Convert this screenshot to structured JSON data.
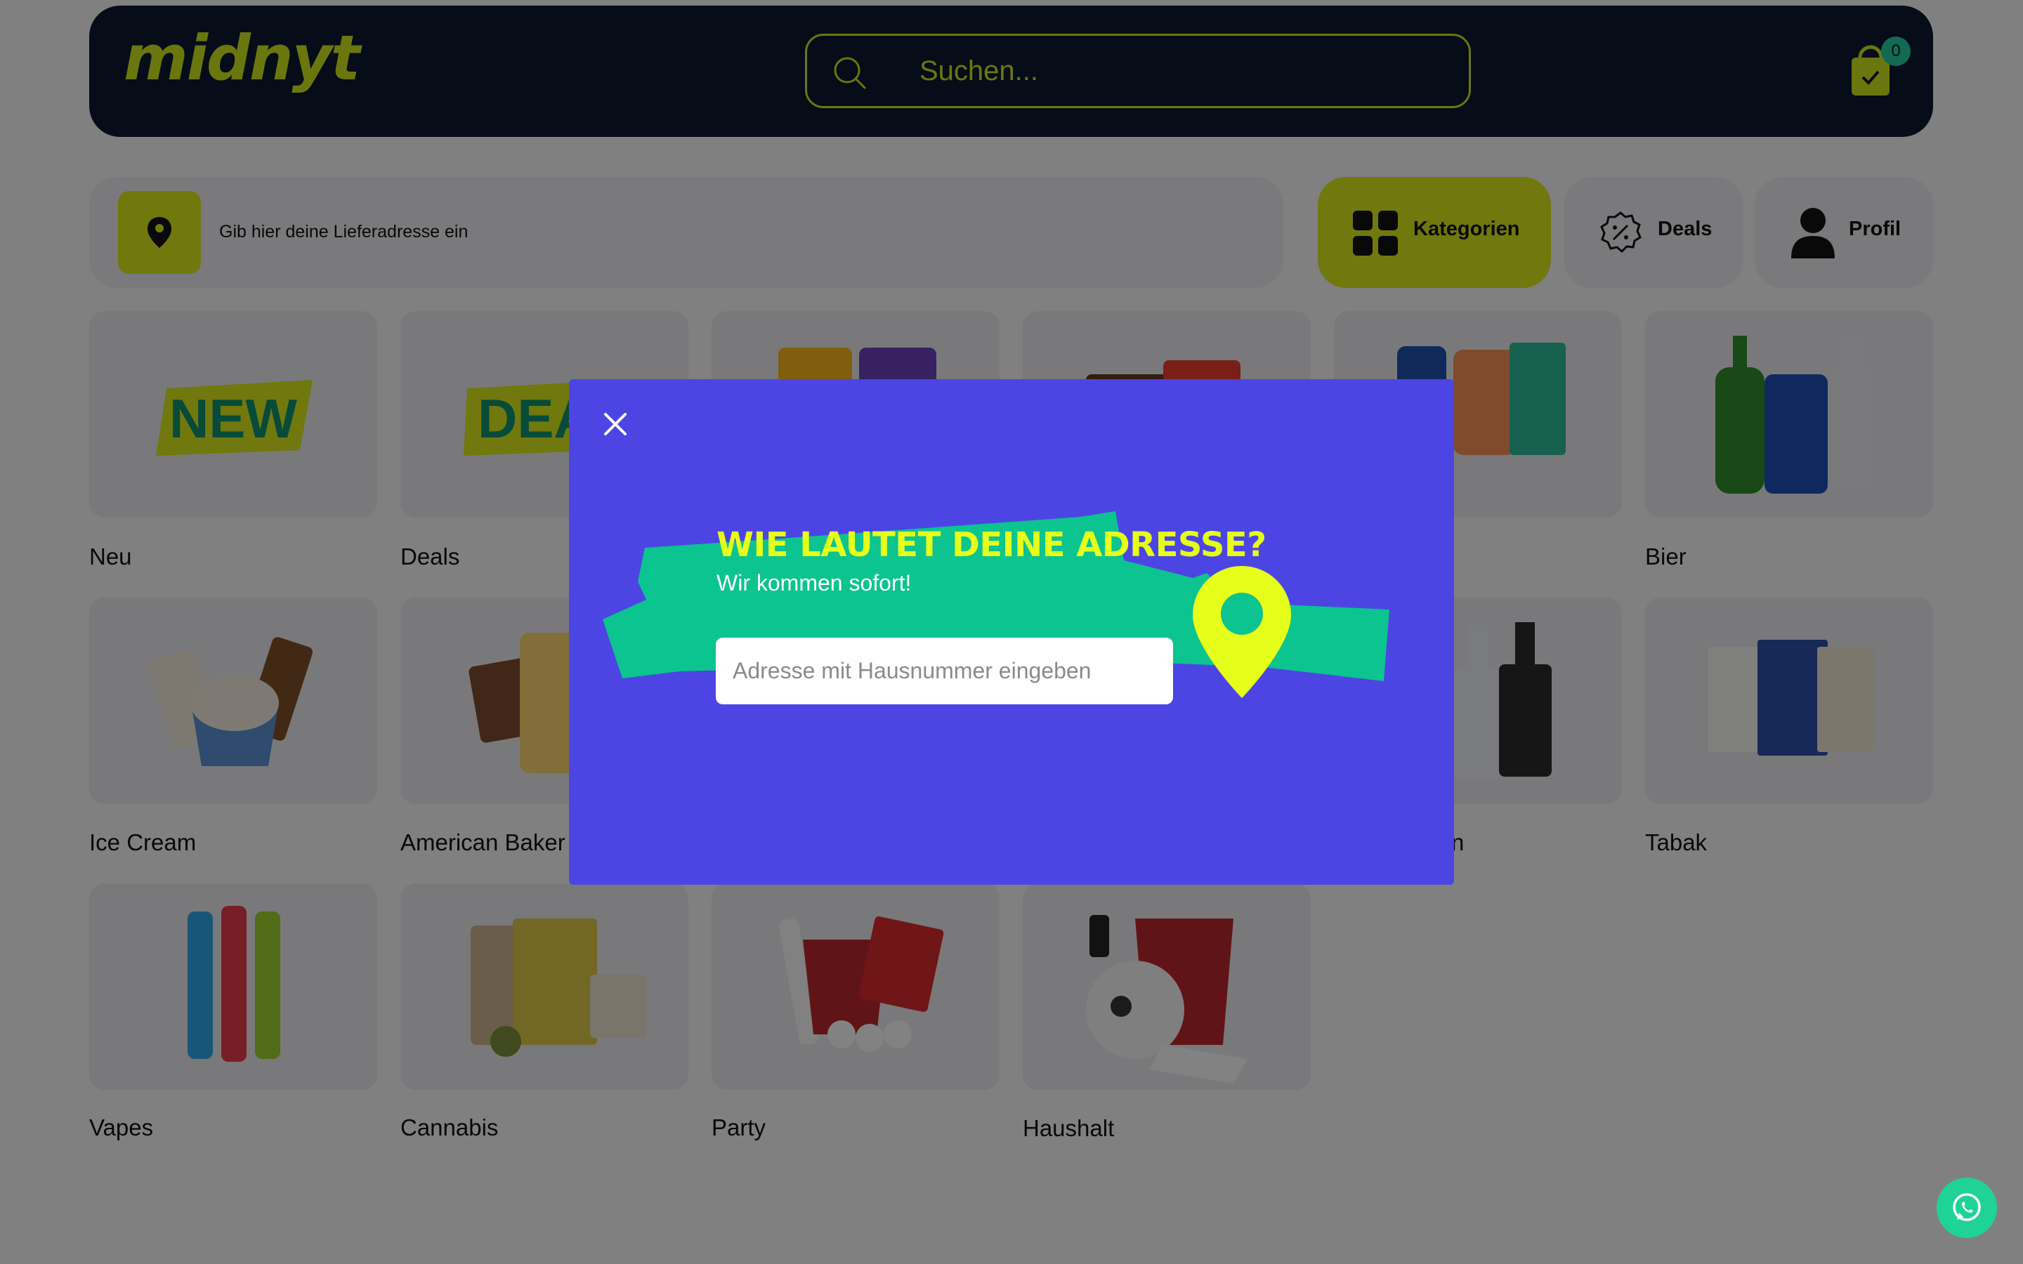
{
  "header": {
    "logo_text": "midnyt",
    "search_placeholder": "Suchen...",
    "cart_count": "0"
  },
  "address_bar": {
    "label": "Gib hier deine Lieferadresse ein"
  },
  "nav": {
    "kategorien": "Kategorien",
    "deals": "Deals",
    "profil": "Profil"
  },
  "tiles": {
    "neu": "Neu",
    "deals": "Deals",
    "bier": "Bier",
    "ice_cream": "Ice Cream",
    "american_bakery": "American Baker",
    "spirits_partial": "n",
    "tabak": "Tabak",
    "vapes": "Vapes",
    "cannabis": "Cannabis",
    "party": "Party",
    "haushalt": "Haushalt",
    "new_badge": "NEW",
    "deal_badge": "DEA"
  },
  "modal": {
    "title": "WIE LAUTET DEINE ADRESSE?",
    "subtitle": "Wir kommen sofort!",
    "input_placeholder": "Adresse mit Hausnummer eingeben"
  },
  "colors": {
    "brand_lime": "#d4e21b",
    "header_navy": "#0f1830",
    "modal_purple": "#4c45e3",
    "banner_green": "#0cc48f",
    "pin_yellow": "#e5ff1a",
    "whatsapp_green": "#1fd396"
  }
}
